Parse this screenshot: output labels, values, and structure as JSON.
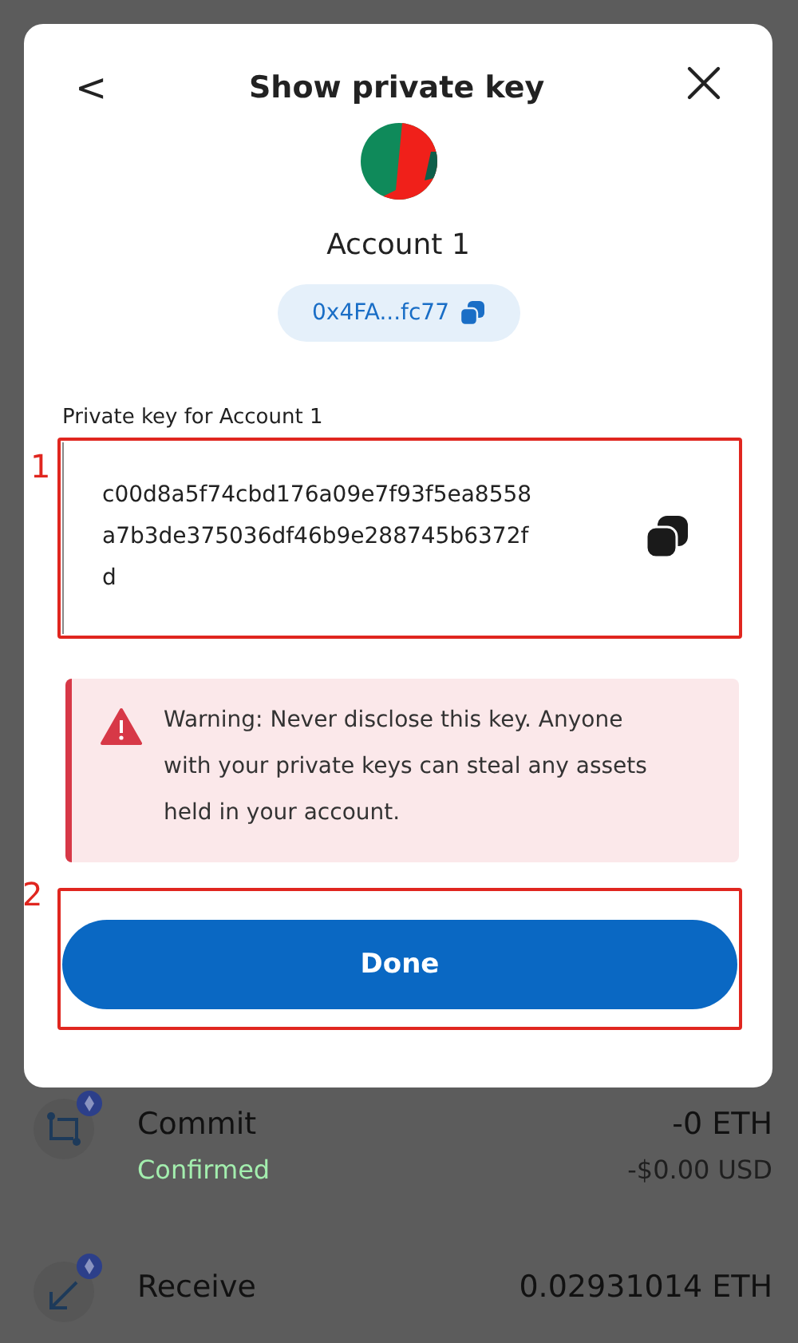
{
  "modal": {
    "title": "Show private key",
    "back_glyph": "<",
    "account_name": "Account 1",
    "address": "0x4FA...fc77",
    "key_label": "Private key for Account 1",
    "private_key_lines": [
      "c00d8a5f74cbd176a09e7f93f5ea8558",
      "a7b3de375036df46b9e288745b6372f",
      "d"
    ],
    "warning": "Warning: Never disclose this key. Anyone with your private keys can steal any assets held in your account.",
    "done_button": "Done"
  },
  "key_annotation": {
    "label": "1"
  },
  "done_annotation": {
    "label": "2"
  },
  "transactions": [
    {
      "kind": "commit",
      "title": "Commit",
      "status": "Confirmed",
      "amount": "-0 ETH",
      "fiat": "-$0.00 USD"
    },
    {
      "kind": "receive",
      "title": "Receive",
      "amount": "0.02931014 ETH"
    }
  ]
}
